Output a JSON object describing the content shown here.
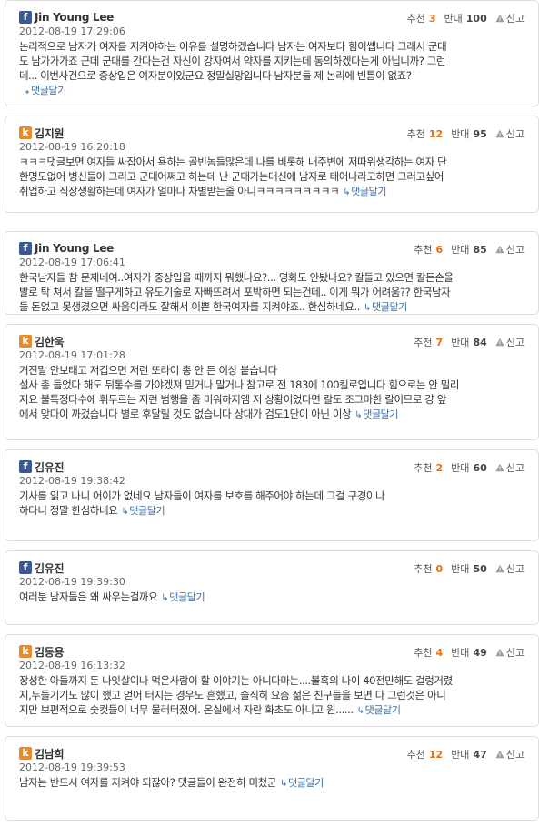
{
  "labels": {
    "recommend": "추천",
    "oppose": "반대",
    "report": "신고",
    "reply": "댓글달기"
  },
  "comments": [
    {
      "service": "facebook",
      "author": "Jin Young Lee",
      "date": "2012-08-19 17:29:06",
      "recommend": "3",
      "oppose": "100",
      "lines": [
        "논리적으로 남자가 여자를 지켜야하는 이유를 설명하겠습니다 남자는 여자보다 힘이쎕니다 그래서 군대",
        "도 남가가가죠 근데 군대를 간다는건 자신이 강자여서 약자를 지키는데 동의하겠다는게 아닙니까? 그런",
        "데... 이번사건으로 중상입은 여자분이있군요 정말실망입니다 남자분들 제 논리에 빈틈이 없죠?"
      ]
    },
    {
      "service": "kakao",
      "author": "김지원",
      "date": "2012-08-19 16:20:18",
      "recommend": "12",
      "oppose": "95",
      "lines": [
        "ㅋㅋㅋ댓글보면 여자들 싸잡아서 욕하는 골빈놈들많은데 나를 비롯해 내주변에 저따위생각하는 여자 단",
        "한명도없어 병신들아 그리고 군대어쩌고 하는데 난 군대가는대신에 남자로 태어나라고하면 그러고싶어",
        "취업하고 직장생활하는데 여자가 얼마나 차별받는줄 아니ㅋㅋㅋㅋㅋㅋㅋㅋㅋ"
      ]
    },
    {
      "service": "facebook",
      "author": "Jin Young Lee",
      "date": "2012-08-19 17:06:41",
      "recommend": "6",
      "oppose": "85",
      "lines": [
        "한국남자들 참 문제네여..여자가 중상입을 때까지 뭐했나요?... 영화도 안봤나요? 칼들고 있으면 칼든손을",
        "발로 탁 쳐서 칼을 떨구게하고 유도기술로 자빠뜨려서 포박하면 되는건데.. 이게 뭐가 어려움?? 한국남자",
        "들 돈없고 못생겼으면 싸움이라도 잘해서 이쁜 한국여자를 지켜야죠.. 한심하네요.."
      ]
    },
    {
      "service": "kakao",
      "author": "김한욱",
      "date": "2012-08-19 17:01:28",
      "recommend": "7",
      "oppose": "84",
      "lines": [
        "거진말 안보태고 저겁으면 저런 또라이 총 안 든 이상 붙습니다",
        "설사 총 들었다 해도 뒤통수를 가야겠져 믿거나 말거나 참고로 전 183에 100킬로입니다 힘으로는 안 밀리",
        "지요 불특정다수에 휘두르는 저런 범행을 좀 미워하지엠 저 상황이었다면 칼도 조그마한 칼이므로 걍 앞",
        "에서 맞다이 까겄습니다 별로 후달릴 것도 없습니다 상대가 검도1단이 아닌 이상"
      ]
    },
    {
      "service": "facebook",
      "author": "김유진",
      "date": "2012-08-19 19:38:42",
      "recommend": "2",
      "oppose": "60",
      "lines": [
        "기사를 읽고 나니 어이가 없네요 남자들이 여자를 보호를 해주어야 하는데 그걸 구경이나",
        "하다니 정말 한심하네요"
      ]
    },
    {
      "service": "facebook",
      "author": "김유진",
      "date": "2012-08-19 19:39:30",
      "recommend": "0",
      "oppose": "50",
      "lines": [
        "여러분 남자들은 왜 싸우는걸까요"
      ]
    },
    {
      "service": "kakao",
      "author": "김동용",
      "date": "2012-08-19 16:13:32",
      "recommend": "4",
      "oppose": "49",
      "lines": [
        "장성한 아들까지 둔 나잇살이나 먹은사람이 할 이야기는 아니다마는....불혹의 나이 40전만해도 걸렁거렸",
        "지,두들기기도 많이 했고 얻어 터지는 경우도 흔했고, 솔직히 요즘 젊은 친구들을 보면 다 그런것은 아니",
        "지만 보편적으로 숫컷들이 너무 물러터졌어. 온실에서 자란 화초도 아니고 원......"
      ]
    },
    {
      "service": "kakao",
      "author": "김남희",
      "date": "2012-08-19 19:39:53",
      "recommend": "12",
      "oppose": "47",
      "lines": [
        "남자는 반드시 여자를 지켜야 되잖아? 댓글들이 완전히 미쳤군"
      ]
    }
  ]
}
